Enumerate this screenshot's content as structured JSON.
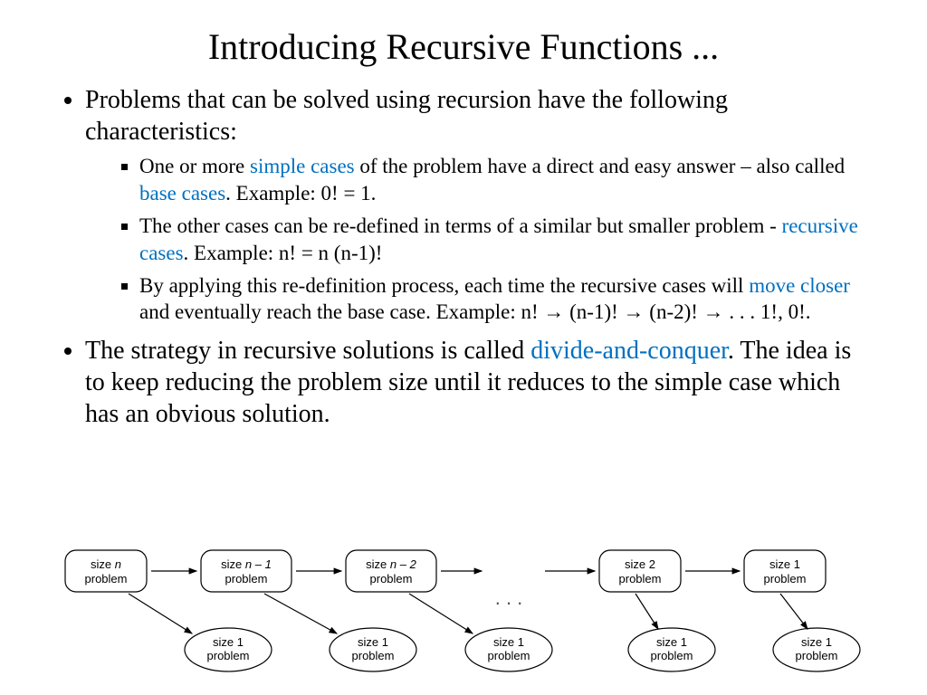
{
  "title": "Introducing Recursive Functions ...",
  "bullets": {
    "b1": "Problems that can be solved using recursion have the following characteristics:",
    "b1a_pre": "One or more ",
    "b1a_hl1": "simple cases",
    "b1a_mid": " of the problem have a direct and easy answer – also called ",
    "b1a_hl2": "base cases",
    "b1a_post": ".  Example:  0! = 1.",
    "b1b_pre": "The other cases can be re-defined in terms of a similar but smaller problem - ",
    "b1b_hl": "recursive cases",
    "b1b_post": ".  Example: n! = n (n-1)!",
    "b1c_pre": "By applying this re-definition process, each time the recursive cases will ",
    "b1c_hl": "move closer",
    "b1c_mid": " and eventually reach the base case.  Example: n! ",
    "b1c_arrow1": "→",
    "b1c_seg2": " (n-1)! ",
    "b1c_arrow2": "→",
    "b1c_seg3": " (n-2)! ",
    "b1c_arrow3": "→",
    "b1c_post": " . . . 1!, 0!.",
    "b2_pre": "The strategy in recursive solutions is called ",
    "b2_hl": "divide-and-conquer",
    "b2_post": ". The idea is to keep reducing the problem size until it reduces to the simple case which has an obvious solution."
  },
  "diagram": {
    "box1a": "size ",
    "box1b": "n",
    "box2a": "size ",
    "box2b": "n – 1",
    "box3a": "size ",
    "box3b": "n – 2",
    "box4": "size 2",
    "box5": "size 1",
    "problem": "problem",
    "oval": "size 1",
    "dots": ". . ."
  }
}
